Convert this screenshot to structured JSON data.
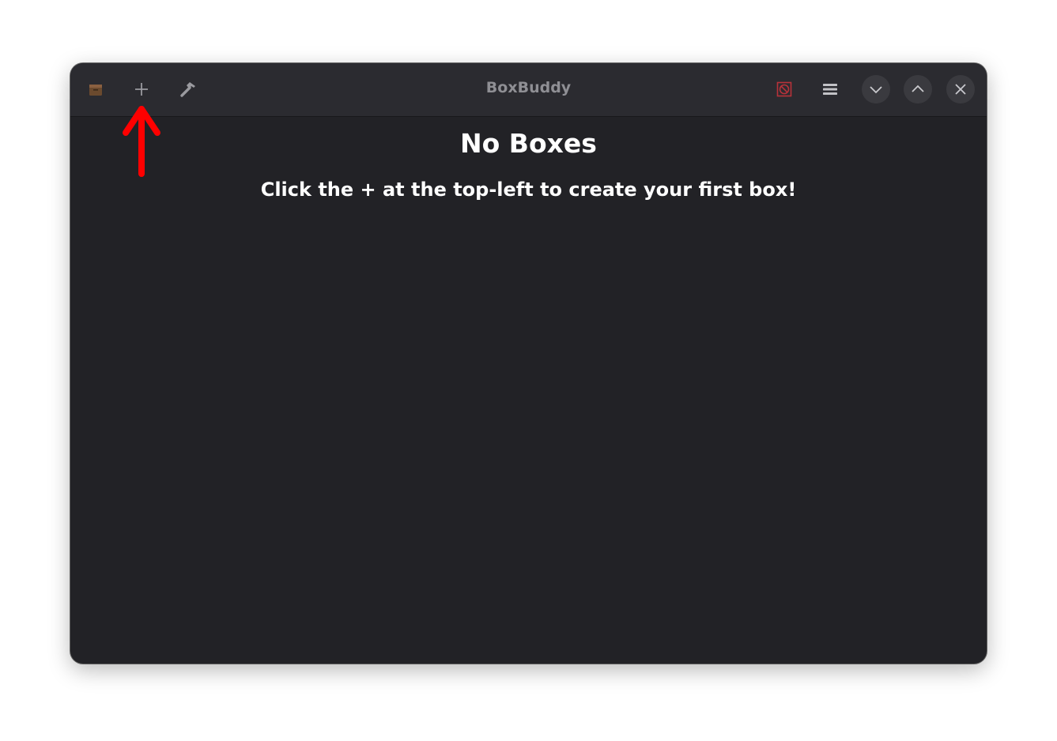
{
  "window": {
    "title": "BoxBuddy"
  },
  "headerbar": {
    "left_buttons": [
      {
        "name": "app-icon",
        "icon": "box-icon"
      },
      {
        "name": "new-box-button",
        "icon": "plus-icon"
      },
      {
        "name": "tools-button",
        "icon": "hammer-icon"
      }
    ],
    "right_buttons": [
      {
        "name": "no-entry-button",
        "icon": "no-entry-icon",
        "color": "#c0392b"
      },
      {
        "name": "menu-button",
        "icon": "hamburger-menu-icon"
      },
      {
        "name": "minimize-button",
        "icon": "chevron-down-icon"
      },
      {
        "name": "maximize-button",
        "icon": "chevron-up-icon"
      },
      {
        "name": "close-button",
        "icon": "close-icon"
      }
    ]
  },
  "empty_state": {
    "title": "No Boxes",
    "description": "Click the + at the top-left to create your first box!"
  },
  "annotation": {
    "icon": "red-arrow-up-icon",
    "color": "#ff0000"
  },
  "colors": {
    "window_bg": "#222226",
    "headerbar_bg": "#2b2b30",
    "title_text": "#8f8f94",
    "content_text": "#ffffff"
  }
}
